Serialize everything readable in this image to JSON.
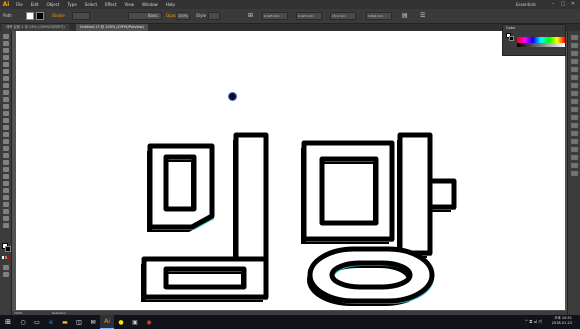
{
  "app": {
    "logo": "Ai",
    "menus": [
      "File",
      "Edit",
      "Object",
      "Type",
      "Select",
      "Effect",
      "View",
      "Window",
      "Help"
    ],
    "workspace": "Essentials",
    "window_controls": [
      "–",
      "□",
      "✕"
    ]
  },
  "control_bar": {
    "selection_label": "Path",
    "stroke_label": "Stroke",
    "brush_label": "Basic",
    "opacity_label": "Opacity",
    "opacity_value": "100%",
    "style_label": "Style",
    "x_value": "0.423 mm",
    "y_value": "0.423 mm",
    "w_value": "15.9 mm",
    "h_value": "9.841 mm"
  },
  "tabs": [
    {
      "label": "제목 없음-1 @ 24% (CMYK/미리보기)",
      "active": false
    },
    {
      "label": "Untitled-17 @ 100% (CMYK/Preview)",
      "active": true
    }
  ],
  "color_panel": {
    "title": "Color",
    "fill": "#ffffff",
    "stroke": "#000000"
  },
  "artwork": {
    "text": "김망",
    "fill_color": "#ffffff",
    "stroke_color": "#000000",
    "accent_color": "#2fc4d8"
  },
  "status": {
    "zoom": "100%",
    "mode": "Selection"
  },
  "taskbar": {
    "start_icon": "windows-icon",
    "apps": [
      "search-icon",
      "task-view-icon",
      "edge-icon",
      "explorer-icon",
      "store-icon",
      "mail-icon",
      "illustrator-icon",
      "kakaotalk-icon",
      "photos-icon",
      "chrome-icon"
    ],
    "tray": "^  ⧉  ◂)  가",
    "time": "오후 10:51",
    "date": "2018-01-23"
  }
}
